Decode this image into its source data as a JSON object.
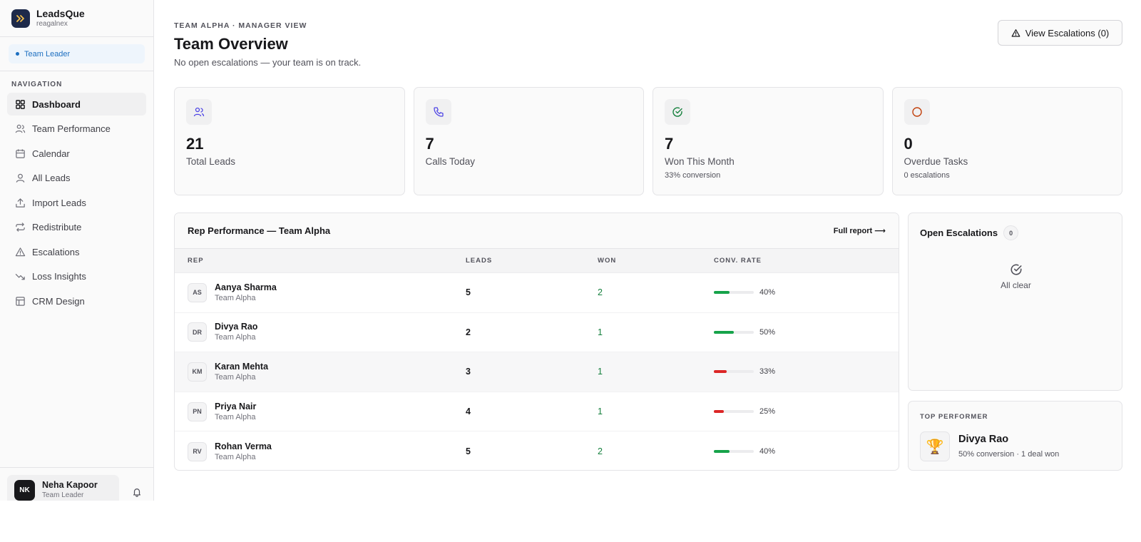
{
  "brand": {
    "name": "LeadsQue",
    "workspace": "reagalnex"
  },
  "role_badge": "Team Leader",
  "nav": {
    "heading": "NAVIGATION",
    "items": [
      {
        "label": "Dashboard",
        "icon": "dashboard-icon",
        "active": true
      },
      {
        "label": "Team Performance",
        "icon": "users-icon"
      },
      {
        "label": "Calendar",
        "icon": "calendar-icon"
      },
      {
        "label": "All Leads",
        "icon": "user-icon"
      },
      {
        "label": "Import Leads",
        "icon": "upload-icon"
      },
      {
        "label": "Redistribute",
        "icon": "repeat-icon"
      },
      {
        "label": "Escalations",
        "icon": "warning-icon"
      },
      {
        "label": "Loss Insights",
        "icon": "trending-down-icon"
      },
      {
        "label": "CRM Design",
        "icon": "layout-icon"
      }
    ]
  },
  "user": {
    "initials": "NK",
    "name": "Neha Kapoor",
    "role": "Team Leader"
  },
  "header": {
    "eyebrow": "TEAM ALPHA · MANAGER VIEW",
    "title": "Team Overview",
    "subtitle": "No open escalations — your team is on track.",
    "escalations_button": "View Escalations (0)"
  },
  "stats": [
    {
      "value": "21",
      "label": "Total Leads",
      "note": "",
      "icon": "users-icon",
      "icon_color": "#4f46e5"
    },
    {
      "value": "7",
      "label": "Calls Today",
      "note": "",
      "icon": "phone-icon",
      "icon_color": "#4f46e5"
    },
    {
      "value": "7",
      "label": "Won This Month",
      "note": "33% conversion",
      "icon": "check-circle-icon",
      "icon_color": "#15803d"
    },
    {
      "value": "0",
      "label": "Overdue Tasks",
      "note": "0 escalations",
      "icon": "circle-icon",
      "icon_color": "#c2410c"
    }
  ],
  "rep_table": {
    "title": "Rep Performance — Team Alpha",
    "link": "Full report ⟶",
    "columns": {
      "rep": "REP",
      "leads": "LEADS",
      "won": "WON",
      "conv": "CONV. RATE"
    },
    "rows": [
      {
        "initials": "AS",
        "name": "Aanya Sharma",
        "team": "Team Alpha",
        "leads": "5",
        "won": "2",
        "conv": "40%",
        "conv_value": 40,
        "bar_color": "#16a34a"
      },
      {
        "initials": "DR",
        "name": "Divya Rao",
        "team": "Team Alpha",
        "leads": "2",
        "won": "1",
        "conv": "50%",
        "conv_value": 50,
        "bar_color": "#16a34a"
      },
      {
        "initials": "KM",
        "name": "Karan Mehta",
        "team": "Team Alpha",
        "leads": "3",
        "won": "1",
        "conv": "33%",
        "conv_value": 33,
        "bar_color": "#dc2626"
      },
      {
        "initials": "PN",
        "name": "Priya Nair",
        "team": "Team Alpha",
        "leads": "4",
        "won": "1",
        "conv": "25%",
        "conv_value": 25,
        "bar_color": "#dc2626"
      },
      {
        "initials": "RV",
        "name": "Rohan Verma",
        "team": "Team Alpha",
        "leads": "5",
        "won": "2",
        "conv": "40%",
        "conv_value": 40,
        "bar_color": "#16a34a"
      }
    ]
  },
  "open_escalations": {
    "title": "Open Escalations",
    "count": "0",
    "empty_text": "All clear"
  },
  "top_performer": {
    "label": "TOP PERFORMER",
    "name": "Divya Rao",
    "meta": "50% conversion · 1 deal won",
    "icon": "🏆"
  }
}
